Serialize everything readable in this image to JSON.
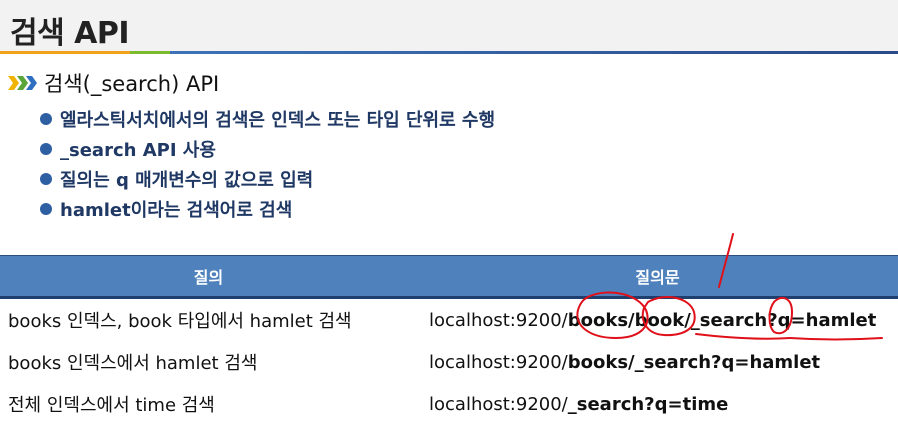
{
  "page_title": "검색 API",
  "section": {
    "heading": "검색(_search) API",
    "bullets": [
      "엘라스틱서치에서의 검색은 인덱스 또는 타입 단위로 수행",
      "_search API 사용",
      "질의는 q 매개변수의 값으로 입력",
      "hamlet이라는 검색어로 검색"
    ]
  },
  "table": {
    "headers": [
      "질의",
      "질의문"
    ],
    "rows": [
      {
        "query": "books 인덱스, book 타입에서 hamlet 검색",
        "url_prefix": "localhost:9200/",
        "url_path": "books/book/_search?q=hamlet"
      },
      {
        "query": "books 인덱스에서 hamlet 검색",
        "url_prefix": "localhost:9200/",
        "url_path": "books/_search?q=hamlet"
      },
      {
        "query": "전체 인덱스에서 time 검색",
        "url_prefix": "localhost:9200/",
        "url_path": "_search?q=time"
      }
    ]
  },
  "colors": {
    "header_bg": "#4f81bd",
    "bullet_text": "#1f3864",
    "annotation_red": "#e0101a"
  }
}
